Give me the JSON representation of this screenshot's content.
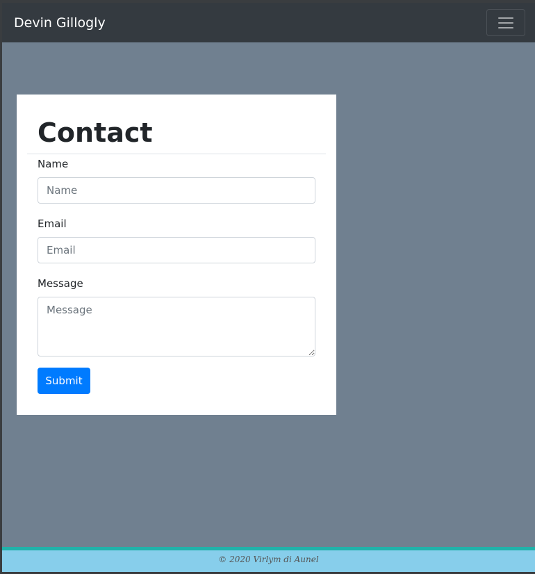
{
  "navbar": {
    "brand": "Devin Gillogly",
    "toggler_icon": "hamburger-icon"
  },
  "contact": {
    "title": "Contact",
    "name": {
      "label": "Name",
      "placeholder": "Name"
    },
    "email": {
      "label": "Email",
      "placeholder": "Email"
    },
    "message": {
      "label": "Message",
      "placeholder": "Message"
    },
    "submit_label": "Submit"
  },
  "footer": {
    "text": "© 2020 Virlym di Aunel"
  },
  "colors": {
    "navbar": "#343a40",
    "page_background": "#708090",
    "primary_button": "#007bff",
    "footer_background": "#87ceeb",
    "footer_border": "#20b2aa"
  }
}
